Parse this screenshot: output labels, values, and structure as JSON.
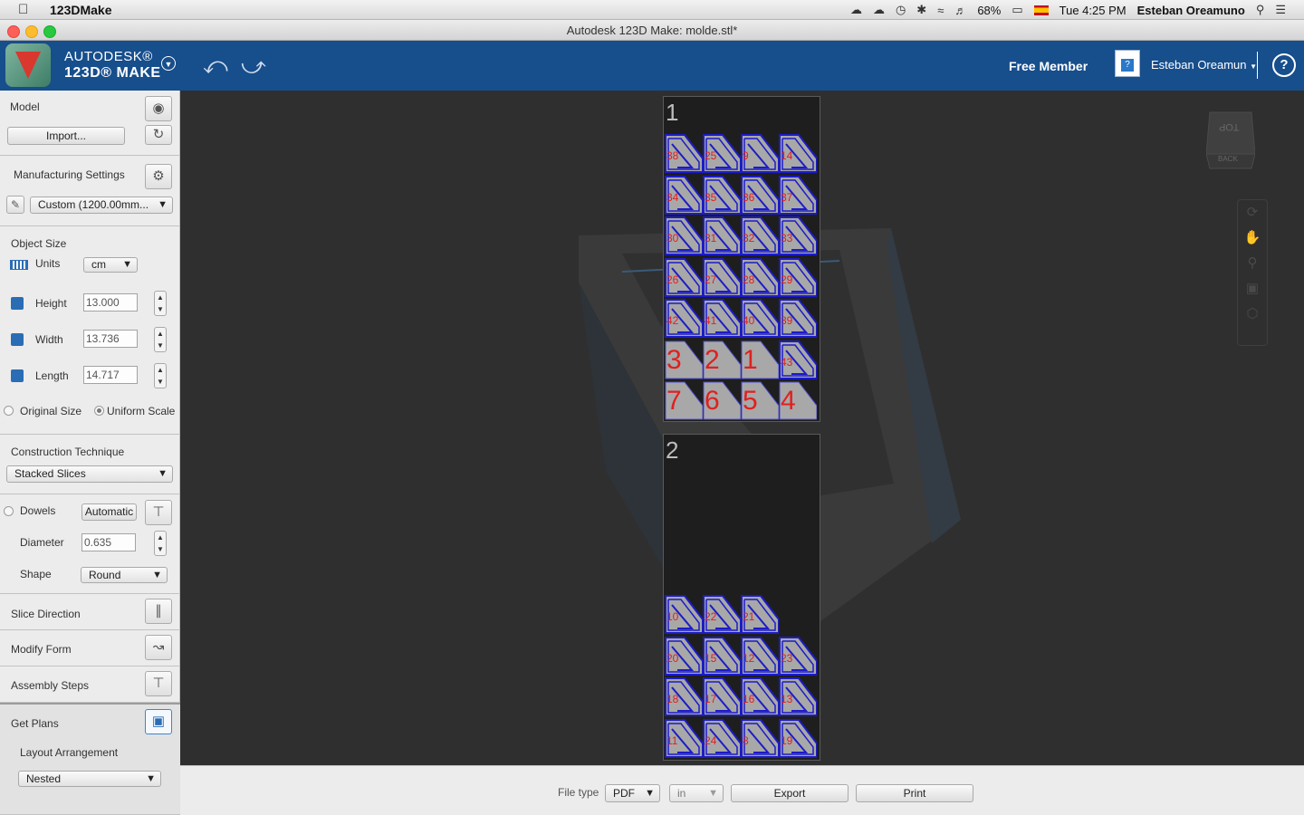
{
  "menubar": {
    "app_name": "123DMake",
    "battery": "68%",
    "clock": "Tue 4:25 PM",
    "user": "Esteban Oreamuno"
  },
  "window": {
    "title": "Autodesk 123D Make: molde.stl*"
  },
  "header": {
    "brand_top": "AUTODESK®",
    "brand_bottom": "123D® MAKE",
    "membership": "Free Member",
    "user_menu": "Esteban Oreamun",
    "help_label": "?"
  },
  "sidebar": {
    "model": {
      "title": "Model",
      "import_label": "Import..."
    },
    "manufacturing": {
      "title": "Manufacturing Settings",
      "preset": "Custom (1200.00mm..."
    },
    "object_size": {
      "title": "Object Size",
      "units_label": "Units",
      "units_value": "cm",
      "height_label": "Height",
      "height_value": "13.000",
      "width_label": "Width",
      "width_value": "13.736",
      "length_label": "Length",
      "length_value": "14.717",
      "original_size_label": "Original Size",
      "uniform_scale_label": "Uniform Scale"
    },
    "construction": {
      "title": "Construction Technique",
      "technique": "Stacked Slices"
    },
    "dowels": {
      "title": "Dowels",
      "mode": "Automatic",
      "diameter_label": "Diameter",
      "diameter_value": "0.635",
      "shape_label": "Shape",
      "shape_value": "Round"
    },
    "slice_direction": "Slice Direction",
    "modify_form": "Modify Form",
    "assembly_steps": "Assembly Steps",
    "get_plans": {
      "title": "Get Plans",
      "layout_label": "Layout Arrangement",
      "layout_value": "Nested"
    }
  },
  "viewport": {
    "viewcube": {
      "top": "TOP",
      "back": "BACK"
    },
    "sheets": [
      {
        "label": "1",
        "rows": [
          [
            "38",
            "25",
            "9",
            "14"
          ],
          [
            "34",
            "35",
            "36",
            "37"
          ],
          [
            "30",
            "31",
            "32",
            "33"
          ],
          [
            "26",
            "27",
            "28",
            "29"
          ],
          [
            "42",
            "41",
            "40",
            "39"
          ],
          [
            "3",
            "2",
            "1",
            "43"
          ],
          [
            "7",
            "6",
            "5",
            "4"
          ]
        ]
      },
      {
        "label": "2",
        "rows": [
          [
            "10",
            "22",
            "21"
          ],
          [
            "20",
            "15",
            "12",
            "23"
          ],
          [
            "18",
            "17",
            "16",
            "13"
          ],
          [
            "11",
            "24",
            "8",
            "19"
          ]
        ]
      }
    ]
  },
  "bottombar": {
    "file_type_label": "File type",
    "file_type_value": "PDF",
    "unit_value": "in",
    "export_label": "Export",
    "print_label": "Print"
  },
  "colors": {
    "header_bg": "#174e8c",
    "piece_fill": "#a8a8a8",
    "piece_outline": "#1c1cc8",
    "piece_label": "#e02020"
  }
}
